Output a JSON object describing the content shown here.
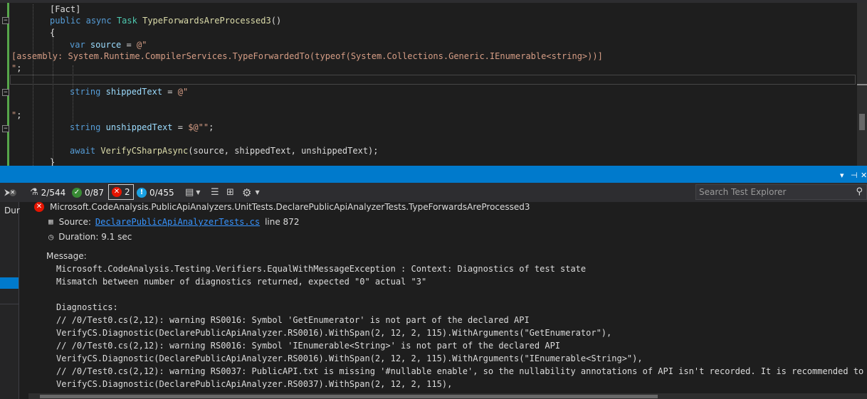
{
  "editor": {
    "lines": [
      {
        "indent": "        ",
        "tokens": [
          {
            "c": "pl",
            "t": "[Fact]"
          }
        ]
      },
      {
        "indent": "        ",
        "tokens": [
          {
            "c": "kw",
            "t": "public"
          },
          {
            "c": "pl",
            "t": " "
          },
          {
            "c": "kw",
            "t": "async"
          },
          {
            "c": "pl",
            "t": " "
          },
          {
            "c": "ty",
            "t": "Task"
          },
          {
            "c": "pl",
            "t": " "
          },
          {
            "c": "fn",
            "t": "TypeForwardsAreProcessed3"
          },
          {
            "c": "pl",
            "t": "()"
          }
        ]
      },
      {
        "indent": "        ",
        "tokens": [
          {
            "c": "pl",
            "t": "{"
          }
        ]
      },
      {
        "indent": "            ",
        "tokens": [
          {
            "c": "kw",
            "t": "var"
          },
          {
            "c": "pl",
            "t": " "
          },
          {
            "c": "var",
            "t": "source"
          },
          {
            "c": "pl",
            "t": " = "
          },
          {
            "c": "str",
            "t": "@\""
          }
        ]
      },
      {
        "indent": "",
        "tokens": [
          {
            "c": "str",
            "t": "[assembly: System.Runtime.CompilerServices.TypeForwardedTo(typeof(System.Collections.Generic.IEnumerable<string>))]"
          }
        ]
      },
      {
        "indent": "",
        "tokens": [
          {
            "c": "str",
            "t": "\""
          },
          {
            "c": "pl",
            "t": ";"
          }
        ]
      },
      {
        "indent": "",
        "tokens": []
      },
      {
        "indent": "            ",
        "tokens": [
          {
            "c": "kw",
            "t": "string"
          },
          {
            "c": "pl",
            "t": " "
          },
          {
            "c": "var",
            "t": "shippedText"
          },
          {
            "c": "pl",
            "t": " = "
          },
          {
            "c": "str",
            "t": "@\""
          }
        ]
      },
      {
        "indent": "",
        "tokens": []
      },
      {
        "indent": "",
        "tokens": [
          {
            "c": "str",
            "t": "\""
          },
          {
            "c": "pl",
            "t": ";"
          }
        ]
      },
      {
        "indent": "            ",
        "tokens": [
          {
            "c": "kw",
            "t": "string"
          },
          {
            "c": "pl",
            "t": " "
          },
          {
            "c": "var",
            "t": "unshippedText"
          },
          {
            "c": "pl",
            "t": " = "
          },
          {
            "c": "str",
            "t": "$@\"\""
          },
          {
            "c": "pl",
            "t": ";"
          }
        ]
      },
      {
        "indent": "",
        "tokens": []
      },
      {
        "indent": "            ",
        "tokens": [
          {
            "c": "kw",
            "t": "await"
          },
          {
            "c": "pl",
            "t": " "
          },
          {
            "c": "fn",
            "t": "VerifyCSharpAsync"
          },
          {
            "c": "pl",
            "t": "(source, shippedText, unshippedText);"
          }
        ]
      },
      {
        "indent": "        ",
        "tokens": [
          {
            "c": "pl",
            "t": "}"
          }
        ]
      }
    ]
  },
  "panel": {
    "title_controls": [
      "▾",
      "⊣",
      "✕"
    ]
  },
  "toolbar": {
    "total": "2/544",
    "passed": "0/87",
    "failed": "2",
    "not_run": "0/455",
    "search_placeholder": "Search Test Explorer"
  },
  "leftstrip": {
    "label": "Dur"
  },
  "details": {
    "test_name": "Microsoft.CodeAnalysis.PublicApiAnalyzers.UnitTests.DeclarePublicApiAnalyzerTests.TypeForwardsAreProcessed3",
    "source_label": "Source:",
    "source_link": "DeclarePublicApiAnalyzerTests.cs",
    "source_line": "line 872",
    "duration": "Duration: 9.1 sec",
    "message_label": "Message:",
    "message_lines": [
      "Microsoft.CodeAnalysis.Testing.Verifiers.EqualWithMessageException : Context: Diagnostics of test state",
      "Mismatch between number of diagnostics returned, expected \"0\" actual \"3\"",
      "",
      "Diagnostics:",
      "// /0/Test0.cs(2,12): warning RS0016: Symbol 'GetEnumerator' is not part of the declared API",
      "VerifyCS.Diagnostic(DeclarePublicApiAnalyzer.RS0016).WithSpan(2, 12, 2, 115).WithArguments(\"GetEnumerator\"),",
      "// /0/Test0.cs(2,12): warning RS0016: Symbol 'IEnumerable<String>' is not part of the declared API",
      "VerifyCS.Diagnostic(DeclarePublicApiAnalyzer.RS0016).WithSpan(2, 12, 2, 115).WithArguments(\"IEnumerable<String>\"),",
      "// /0/Test0.cs(2,12): warning RS0037: PublicAPI.txt is missing '#nullable enable', so the nullability annotations of API isn't recorded. It is recommended to",
      "VerifyCS.Diagnostic(DeclarePublicApiAnalyzer.RS0037).WithSpan(2, 12, 2, 115),"
    ]
  },
  "colors": {
    "accent": "#007acc",
    "fail": "#e51400",
    "pass": "#388a34",
    "info": "#1ba1e2",
    "link": "#3794ff"
  },
  "icons": {
    "fail": "error-circle-icon",
    "pass": "check-circle-icon",
    "info": "info-circle-icon",
    "beaker": "flask-icon",
    "settings": "gear-icon",
    "search": "search-icon"
  }
}
